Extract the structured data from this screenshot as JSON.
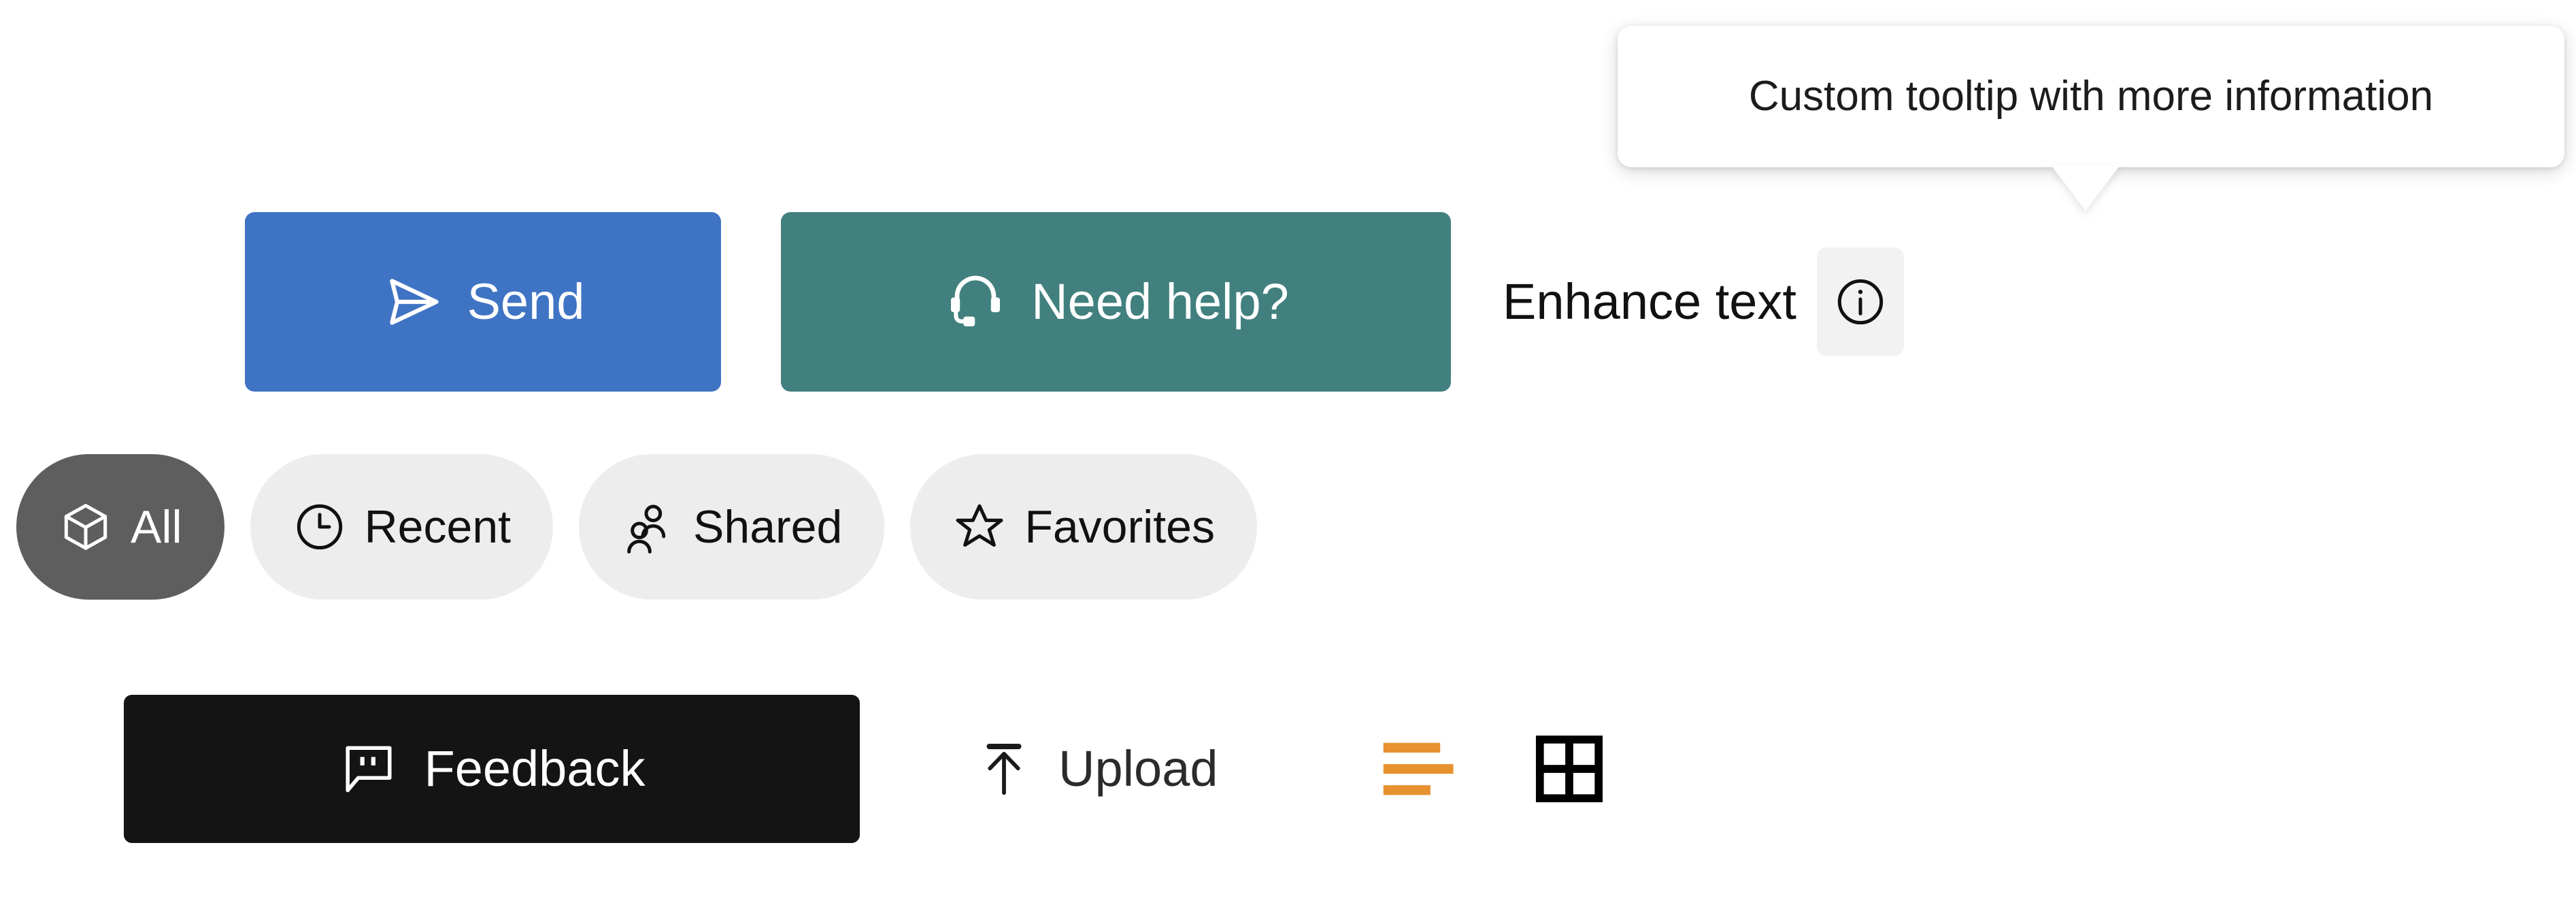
{
  "tooltip": {
    "text": "Custom tooltip with more information",
    "icon": "tooltip-arrow"
  },
  "actions": {
    "send": {
      "label": "Send",
      "icon": "send-icon",
      "color": "#3f74c4"
    },
    "help": {
      "label": "Need help?",
      "icon": "headset-icon",
      "color": "#41807e"
    },
    "enhance": {
      "label": "Enhance text",
      "info_icon": "info-circle-icon",
      "info_button_color": "#f2f2f2"
    }
  },
  "filters": {
    "items": [
      {
        "label": "All",
        "icon": "cube-icon",
        "selected": true
      },
      {
        "label": "Recent",
        "icon": "clock-icon",
        "selected": false
      },
      {
        "label": "Shared",
        "icon": "people-icon",
        "selected": false
      },
      {
        "label": "Favorites",
        "icon": "star-icon",
        "selected": false
      }
    ],
    "active_color": "#5e5e5e",
    "inactive_color": "#ededed"
  },
  "bottom_bar": {
    "feedback": {
      "label": "Feedback",
      "icon": "comment-quote-icon",
      "color": "#141414"
    },
    "upload": {
      "label": "Upload",
      "icon": "arrow-up-to-line-icon"
    },
    "list_view": {
      "icon": "list-view-icon",
      "color": "#e8912f"
    },
    "grid_view": {
      "icon": "grid-view-icon",
      "color": "#000000"
    }
  }
}
